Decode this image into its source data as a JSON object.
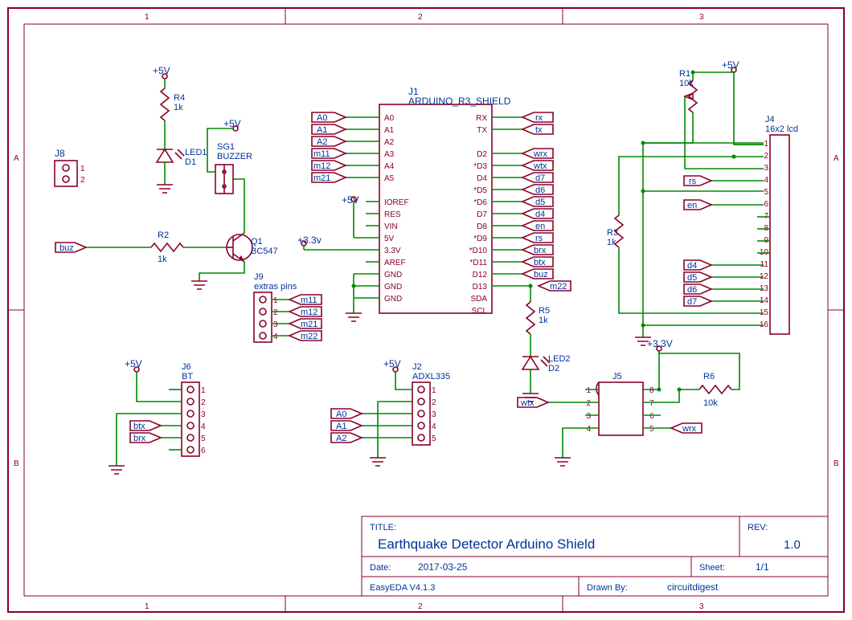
{
  "title_block": {
    "title_label": "TITLE:",
    "title": "Earthquake Detector Arduino Shield",
    "rev_label": "REV:",
    "rev": "1.0",
    "date_label": "Date:",
    "date": "2017-03-25",
    "sheet_label": "Sheet:",
    "sheet": "1/1",
    "tool": "EasyEDA V4.1.3",
    "drawn_label": "Drawn By:",
    "drawn": "circuitdigest"
  },
  "frame": {
    "cols": [
      "1",
      "2",
      "3"
    ],
    "rows": [
      "A",
      "B"
    ]
  },
  "power": {
    "v5": "+5V",
    "v33": "+3.3v",
    "v33u": "+3.3V"
  },
  "components": {
    "R1": {
      "ref": "R1",
      "val": "10k"
    },
    "R2": {
      "ref": "R2",
      "val": "1k"
    },
    "R3": {
      "ref": "R3",
      "val": "1k"
    },
    "R4": {
      "ref": "R4",
      "val": "1k"
    },
    "R5": {
      "ref": "R5",
      "val": "1k"
    },
    "R6": {
      "ref": "R6",
      "val": "10k"
    },
    "Q1": {
      "ref": "Q1",
      "val": "BC547"
    },
    "D1": {
      "ref": "LED1",
      "val": "D1"
    },
    "D2": {
      "ref": "LED2",
      "val": "D2"
    },
    "SG1": {
      "ref": "SG1",
      "val": "BUZZER"
    },
    "J1": {
      "ref": "J1",
      "val": "ARDUINO_R3_SHIELD"
    },
    "J2": {
      "ref": "J2",
      "val": "ADXL335"
    },
    "J4": {
      "ref": "J4",
      "val": "16x2 lcd"
    },
    "J5": {
      "ref": "J5"
    },
    "J6": {
      "ref": "J6",
      "val": "BT"
    },
    "J8": {
      "ref": "J8"
    },
    "J9": {
      "ref": "J9",
      "val": "extras pins"
    }
  },
  "arduino_pins": {
    "left": [
      "A0",
      "A1",
      "A2",
      "A3",
      "A4",
      "A5",
      "",
      "IOREF",
      "RES",
      "VIN",
      "5V",
      "3.3V",
      "AREF",
      "GND",
      "GND",
      "GND"
    ],
    "right": [
      "RX",
      "TX",
      "",
      "D2",
      "*D3",
      "D4",
      "*D5",
      "*D6",
      "D7",
      "D8",
      "*D9",
      "*D10",
      "*D11",
      "D12",
      "D13",
      "SDA",
      "SCL"
    ]
  },
  "netlabels": {
    "a_left": [
      "A0",
      "A1",
      "A2",
      "m11",
      "m12",
      "m21"
    ],
    "a_right": [
      "rx",
      "tx",
      "",
      "wrx",
      "wtx",
      "d7",
      "d6",
      "d5",
      "d4",
      "en",
      "rs",
      "brx",
      "btx",
      "buz"
    ],
    "m22": "m22",
    "buz": "buz",
    "j9": [
      "m11",
      "m12",
      "m21",
      "m22"
    ],
    "bt": [
      "btx",
      "brx"
    ],
    "adxl": [
      "A0",
      "A1",
      "A2"
    ],
    "lcd": [
      "rs",
      "en",
      "d4",
      "d5",
      "d6",
      "d7"
    ],
    "esp": [
      "wtx",
      "wrx"
    ]
  },
  "pin_nums": {
    "j8": [
      "1",
      "2"
    ],
    "j9": [
      "1",
      "2",
      "3",
      "4"
    ],
    "j6": [
      "1",
      "2",
      "3",
      "4",
      "5",
      "6"
    ],
    "j2": [
      "1",
      "2",
      "3",
      "4",
      "5"
    ],
    "j5l": [
      "1",
      "2",
      "3",
      "4"
    ],
    "j5r": [
      "8",
      "7",
      "6",
      "5"
    ],
    "j4": [
      "1",
      "2",
      "3",
      "4",
      "5",
      "6",
      "7",
      "8",
      "9",
      "10",
      "11",
      "12",
      "13",
      "14",
      "15",
      "16"
    ]
  }
}
